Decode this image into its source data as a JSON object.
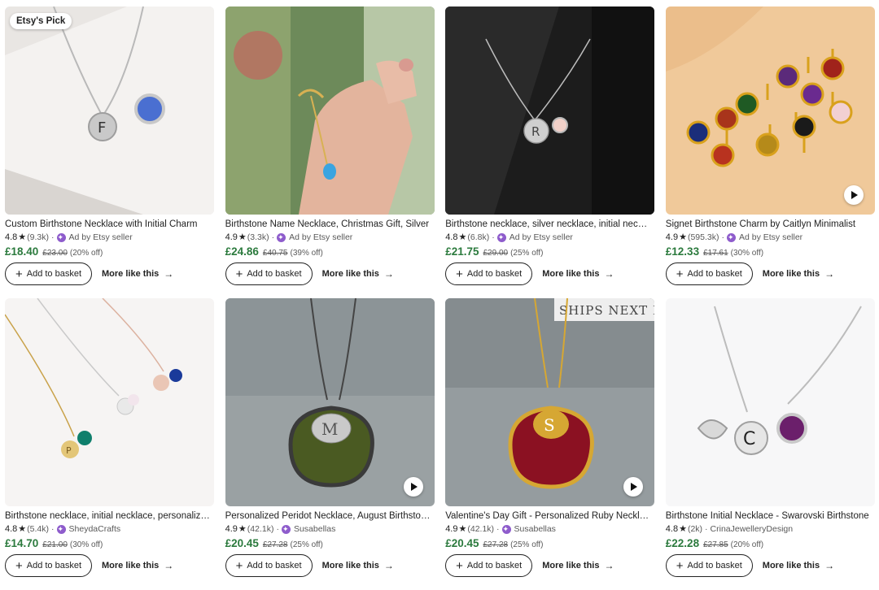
{
  "products": [
    {
      "badge": "Etsy's Pick",
      "title": "Custom Birthstone Necklace with Initial Charm",
      "rating": "4.8",
      "reviews": "(9.3k)",
      "seller": "Ad by Etsy seller",
      "price": "£18.40",
      "original_price": "£23.00",
      "discount": "(20% off)",
      "has_video": false
    },
    {
      "badge": "",
      "title": "Birthstone Name Necklace, Christmas Gift, Silver",
      "rating": "4.9",
      "reviews": "(3.3k)",
      "seller": "Ad by Etsy seller",
      "price": "£24.86",
      "original_price": "£40.75",
      "discount": "(39% off)",
      "has_video": false
    },
    {
      "badge": "",
      "title": "Birthstone necklace, silver necklace, initial necklace",
      "rating": "4.8",
      "reviews": "(6.8k)",
      "seller": "Ad by Etsy seller",
      "price": "£21.75",
      "original_price": "£29.00",
      "discount": "(25% off)",
      "has_video": false
    },
    {
      "badge": "",
      "title": "Signet Birthstone Charm by Caitlyn Minimalist",
      "rating": "4.9",
      "reviews": "(595.3k)",
      "seller": "Ad by Etsy seller",
      "price": "£12.33",
      "original_price": "£17.61",
      "discount": "(30% off)",
      "has_video": true
    },
    {
      "badge": "",
      "title": "Birthstone necklace, initial necklace, personalized",
      "rating": "4.8",
      "reviews": "(5.4k)",
      "seller": "SheydaCrafts",
      "price": "£14.70",
      "original_price": "£21.00",
      "discount": "(30% off)",
      "has_video": false
    },
    {
      "badge": "",
      "title": "Personalized Peridot Necklace, August Birthstone",
      "rating": "4.9",
      "reviews": "(42.1k)",
      "seller": "Susabellas",
      "price": "£20.45",
      "original_price": "£27.28",
      "discount": "(25% off)",
      "has_video": true
    },
    {
      "badge": "",
      "title": "Valentine's Day Gift - Personalized Ruby Necklace",
      "rating": "4.9",
      "reviews": "(42.1k)",
      "seller": "Susabellas",
      "price": "£20.45",
      "original_price": "£27.28",
      "discount": "(25% off)",
      "has_video": true,
      "overlay_text": "SHIPS NEXT D"
    },
    {
      "badge": "",
      "title": "Birthstone Initial Necklace - Swarovski Birthstone",
      "rating": "4.8",
      "reviews": "(2k)",
      "seller": "CrinaJewelleryDesign",
      "price": "£22.28",
      "original_price": "£27.85",
      "discount": "(20% off)",
      "has_video": false
    }
  ],
  "labels": {
    "add_to_basket": "Add to basket",
    "more_like_this": "More like this"
  },
  "colors": {
    "price": "#2b7a3d",
    "star_seller": "#8e5ccc"
  }
}
